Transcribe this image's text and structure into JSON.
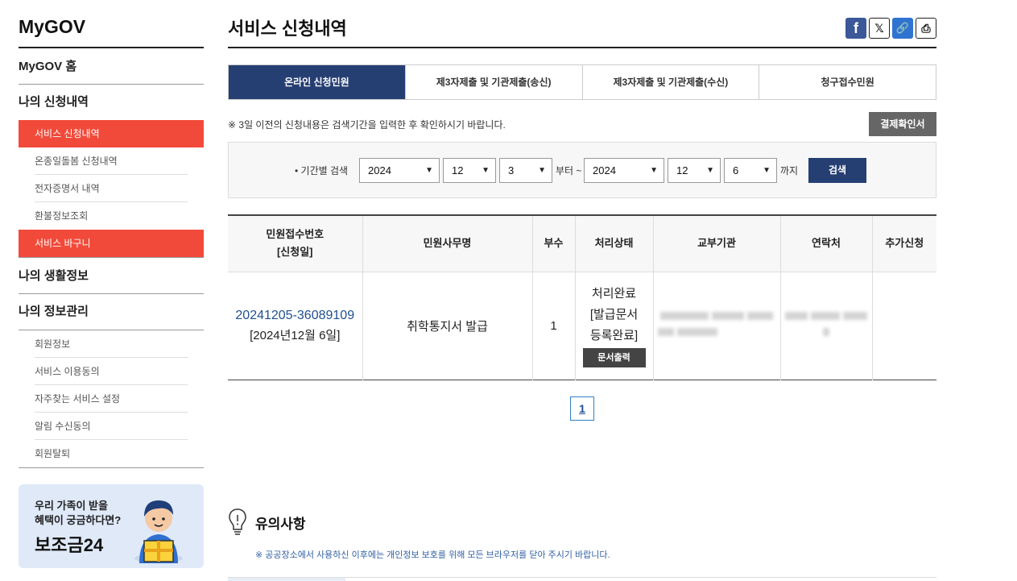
{
  "sidebar": {
    "title": "MyGOV",
    "home": "MyGOV 홈",
    "section_apply": "나의 신청내역",
    "apply_items": [
      "서비스 신청내역",
      "온종일돌봄 신청내역",
      "전자증명서 내역",
      "환불정보조회",
      "서비스 바구니"
    ],
    "section_life": "나의 생활정보",
    "section_info": "나의 정보관리",
    "info_items": [
      "회원정보",
      "서비스 이용동의",
      "자주찾는 서비스 설정",
      "알림 수신동의",
      "회원탈퇴"
    ],
    "banner": {
      "line1": "우리 가족이 받을",
      "line2": "혜택이 궁금하다면?",
      "brand": "보조금24"
    }
  },
  "main": {
    "title": "서비스 신청내역",
    "share": {
      "facebook": "f",
      "x": "𝕏",
      "link": "🔗",
      "print": "⎙"
    },
    "tabs": [
      "온라인 신청민원",
      "제3자제출 및 기관제출(송신)",
      "제3자제출 및 기관제출(수신)",
      "청구접수민원"
    ],
    "active_tab": 0,
    "notice": "※ 3일 이전의 신청내용은 검색기간을 입력한 후 확인하시기 바랍니다.",
    "payment_button": "결제확인서",
    "search": {
      "label": "기간별 검색",
      "from_year": "2024",
      "from_month": "12",
      "from_day": "3",
      "from_text": "부터 ~",
      "to_year": "2024",
      "to_month": "12",
      "to_day": "6",
      "to_text": "까지",
      "button": "검색"
    },
    "table": {
      "headers": {
        "receipt_line1": "민원접수번호",
        "receipt_line2": "[신청일]",
        "name": "민원사무명",
        "copies": "부수",
        "status": "처리상태",
        "agency": "교부기관",
        "contact": "연락처",
        "extra": "추가신청"
      },
      "rows": [
        {
          "receipt_no": "20241205-36089109",
          "date": "[2024년12월 6일]",
          "name": "취학통지서 발급",
          "copies": "1",
          "status_line1": "처리완료",
          "status_line2": "[발급문서",
          "status_line3": "등록완료]",
          "doc_button": "문서출력"
        }
      ]
    },
    "pagination": {
      "current": "1"
    },
    "caution": {
      "title": "유의사항",
      "text": "※  공공장소에서 사용하신 이후에는 개인정보 보호를 위해 모든 브라우저를 닫아 주시기 바랍니다."
    }
  },
  "colors": {
    "primary_navy": "#263f73",
    "active_red": "#f24a3a",
    "link_blue": "#1f4f8f"
  }
}
